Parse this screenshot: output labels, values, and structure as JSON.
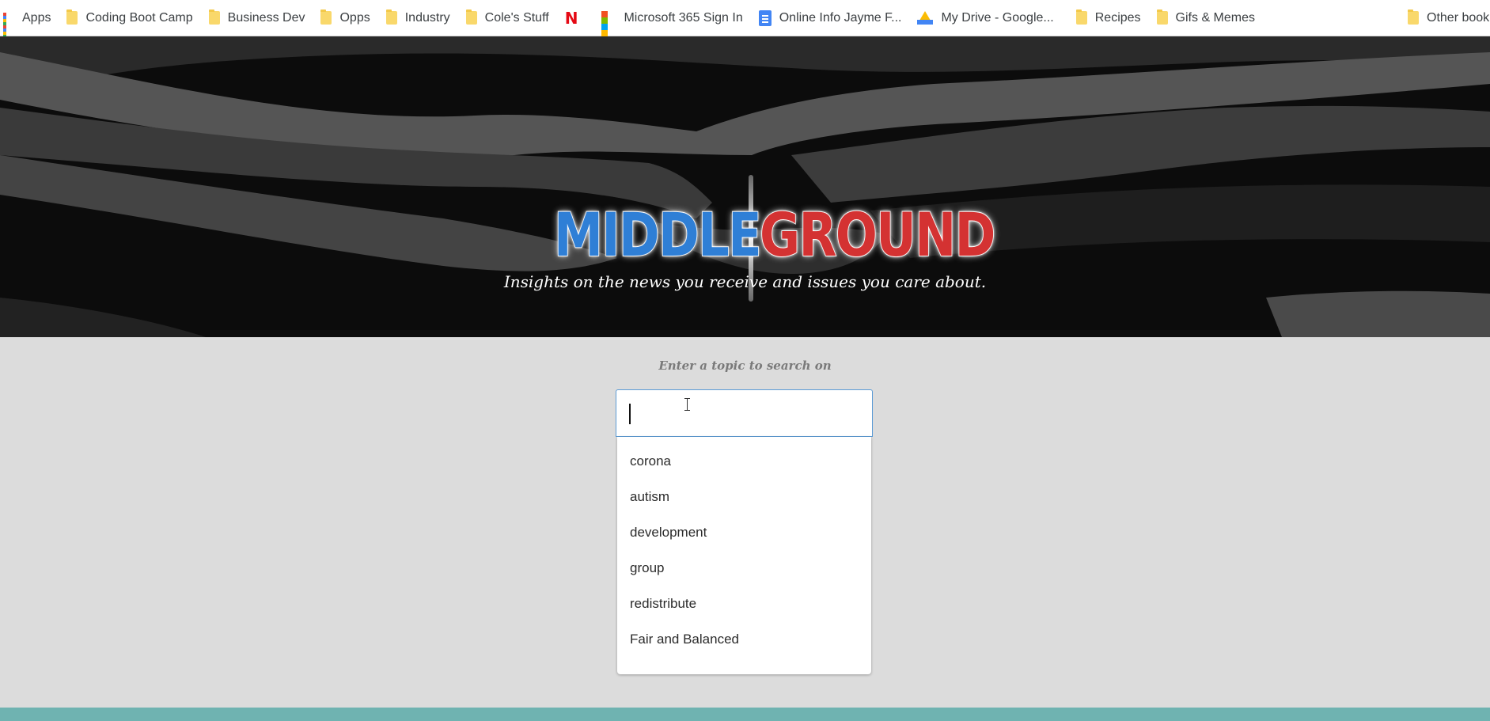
{
  "bookmarks": {
    "apps": "Apps",
    "items": [
      {
        "label": "Coding Boot Camp",
        "icon": "folder-icon"
      },
      {
        "label": "Business Dev",
        "icon": "folder-icon"
      },
      {
        "label": "Opps",
        "icon": "folder-icon"
      },
      {
        "label": "Industry",
        "icon": "folder-icon"
      },
      {
        "label": "Cole's Stuff",
        "icon": "folder-icon"
      },
      {
        "label": "",
        "icon": "netflix-icon"
      },
      {
        "label": "Microsoft 365 Sign In",
        "icon": "microsoft-icon"
      },
      {
        "label": "Online Info Jayme F...",
        "icon": "google-docs-icon"
      },
      {
        "label": "My Drive - Google...",
        "icon": "google-drive-icon"
      },
      {
        "label": "Recipes",
        "icon": "folder-icon"
      },
      {
        "label": "Gifs & Memes",
        "icon": "folder-icon"
      }
    ],
    "other": "Other bookmarks",
    "netflix_glyph": "N"
  },
  "hero": {
    "logo_left": "MIDDLE",
    "logo_right": "GROUND",
    "tagline": "Insights on the news you receive and issues you care about."
  },
  "search": {
    "label": "Enter a topic to search on",
    "value": "",
    "suggestions": [
      "corona",
      "autism",
      "development",
      "group",
      "redistribute",
      "Fair and Balanced"
    ]
  },
  "colors": {
    "logo_blue": "#2f7fd6",
    "logo_red": "#d43232",
    "input_border": "#5b9bd5",
    "footer": "#6fb3b1"
  }
}
